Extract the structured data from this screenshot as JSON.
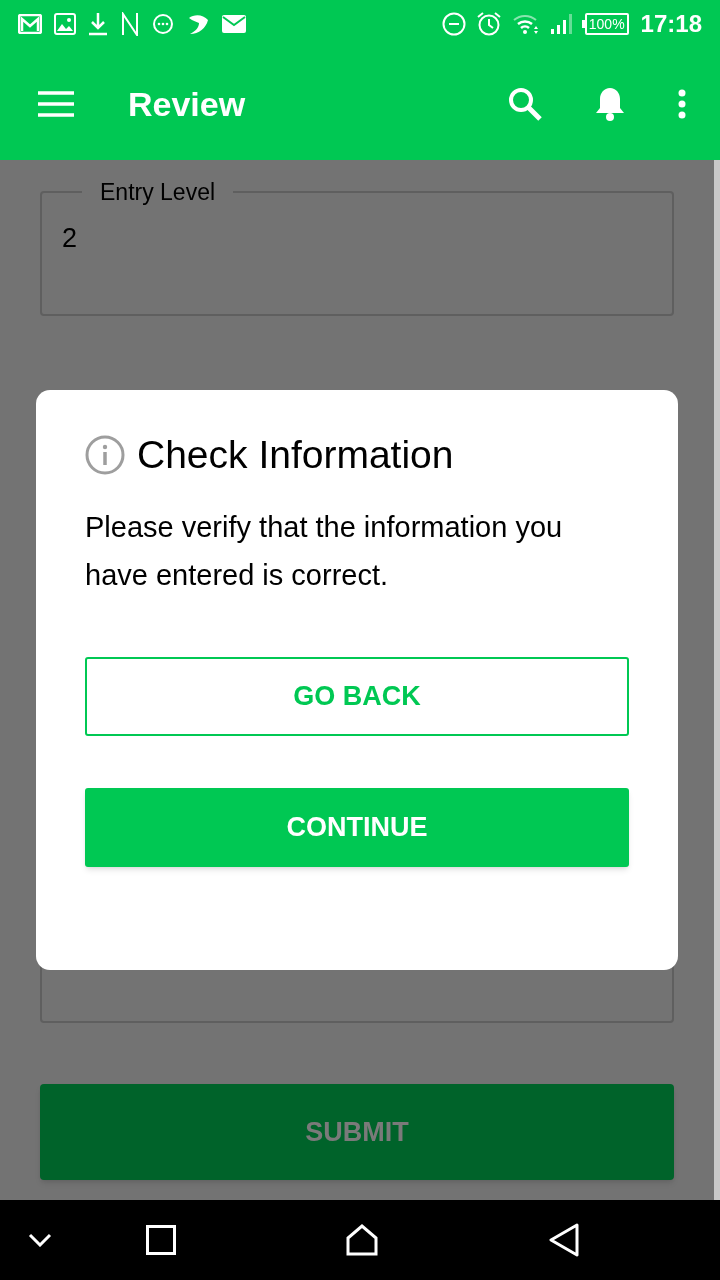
{
  "status_bar": {
    "battery": "100%",
    "time": "17:18"
  },
  "app_bar": {
    "title": "Review"
  },
  "form": {
    "fields": [
      {
        "label": "Entry Level",
        "value": "2"
      }
    ],
    "submit": "SUBMIT"
  },
  "dialog": {
    "title": "Check Information",
    "message": "Please verify that the information you have entered is correct.",
    "buttons": [
      {
        "label": "GO BACK",
        "kind": "outlined"
      },
      {
        "label": "CONTINUE",
        "kind": "filled"
      }
    ]
  }
}
